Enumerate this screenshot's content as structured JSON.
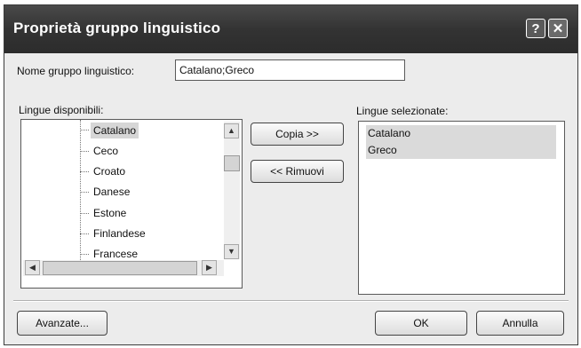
{
  "window": {
    "title": "Proprietà gruppo linguistico",
    "help_glyph": "?",
    "close_glyph": "✕"
  },
  "name_field": {
    "label": "Nome gruppo linguistico:",
    "value": "Catalano;Greco"
  },
  "available": {
    "label": "Lingue disponibili:",
    "items": [
      "Catalano",
      "Ceco",
      "Croato",
      "Danese",
      "Estone",
      "Finlandese",
      "Francese"
    ],
    "selected_index": 0,
    "scroll_up": "▲",
    "scroll_down": "▼",
    "scroll_left": "◀",
    "scroll_right": "▶"
  },
  "buttons": {
    "copy": "Copia >>",
    "remove": "<< Rimuovi",
    "advanced": "Avanzate...",
    "ok": "OK",
    "cancel": "Annulla"
  },
  "selected": {
    "label": "Lingue selezionate:",
    "items": [
      "Catalano",
      "Greco"
    ]
  }
}
